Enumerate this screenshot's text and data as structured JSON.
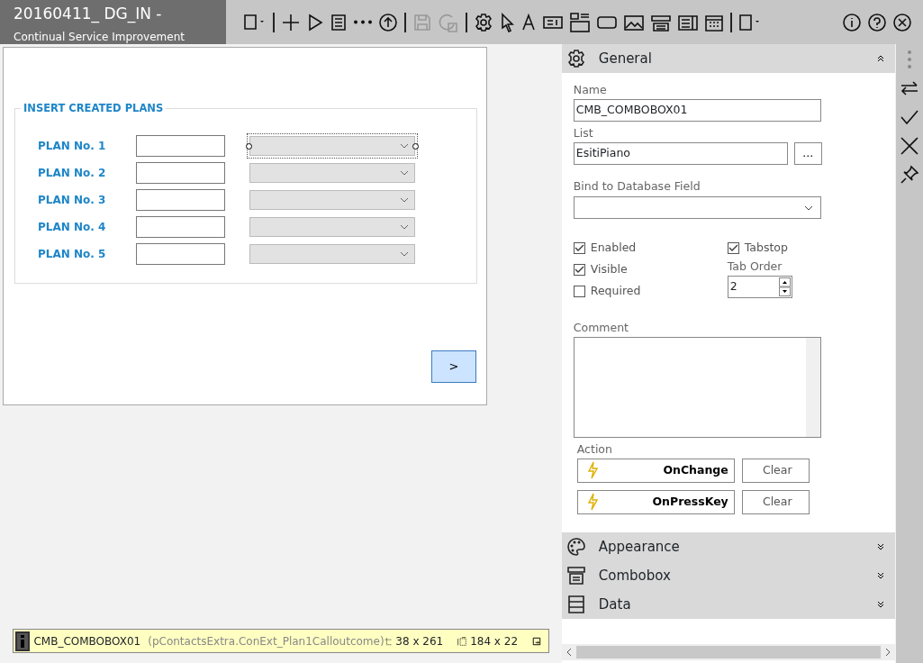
{
  "window": {
    "title": "20160411_ DG_IN -",
    "subtitle": "Continual Service Improvement"
  },
  "toolbar": [
    {
      "kind": "new-page",
      "disabled": false
    },
    {
      "kind": "separator"
    },
    {
      "kind": "add",
      "disabled": false
    },
    {
      "kind": "run",
      "disabled": false
    },
    {
      "kind": "list",
      "disabled": false
    },
    {
      "kind": "more",
      "disabled": false
    },
    {
      "kind": "upload",
      "disabled": false
    },
    {
      "kind": "separator"
    },
    {
      "kind": "save",
      "disabled": true
    },
    {
      "kind": "refresh",
      "disabled": true
    },
    {
      "kind": "separator"
    },
    {
      "kind": "settings",
      "disabled": false
    },
    {
      "kind": "pointer",
      "disabled": false
    },
    {
      "kind": "text",
      "disabled": false
    },
    {
      "kind": "textfield",
      "disabled": false
    },
    {
      "kind": "labelfield",
      "disabled": false
    },
    {
      "kind": "button",
      "disabled": false
    },
    {
      "kind": "image",
      "disabled": false
    },
    {
      "kind": "combobox",
      "disabled": false
    },
    {
      "kind": "listbox",
      "disabled": false
    },
    {
      "kind": "calendar",
      "disabled": false
    },
    {
      "kind": "separator"
    },
    {
      "kind": "page-menu",
      "disabled": false
    }
  ],
  "window_buttons": [
    {
      "kind": "info"
    },
    {
      "kind": "help"
    },
    {
      "kind": "close"
    }
  ],
  "form": {
    "group_title": "INSERT CREATED PLANS",
    "plans": [
      {
        "label": "PLAN No. 1",
        "selected": true
      },
      {
        "label": "PLAN No. 2",
        "selected": false
      },
      {
        "label": "PLAN No. 3",
        "selected": false
      },
      {
        "label": "PLAN No. 4",
        "selected": false
      },
      {
        "label": "PLAN No. 5",
        "selected": false
      }
    ],
    "next_button": ">"
  },
  "status_bar": {
    "name": "CMB_COMBOBOX01",
    "source": "(pContactsExtra.ConExt_Plan1Calloutcome)",
    "position": "38 x 261",
    "size": "184 x 22"
  },
  "properties": {
    "sections": [
      {
        "kind": "general",
        "title": "General",
        "expanded": true
      },
      {
        "kind": "appearance",
        "title": "Appearance",
        "expanded": false
      },
      {
        "kind": "combobox",
        "title": "Combobox",
        "expanded": false
      },
      {
        "kind": "data",
        "title": "Data",
        "expanded": false
      }
    ],
    "name_label": "Name",
    "name_value": "CMB_COMBOBOX01",
    "list_label": "List",
    "list_value": "EsitiPiano",
    "list_button": "...",
    "bind_label": "Bind to Database Field",
    "checks_left": [
      {
        "label": "Enabled",
        "checked": true
      },
      {
        "label": "Visible",
        "checked": true
      },
      {
        "label": "Required",
        "checked": false
      }
    ],
    "tabstop": {
      "label": "Tabstop",
      "checked": true
    },
    "tab_order_label": "Tab Order",
    "tab_order_value": "2",
    "comment_label": "Comment",
    "action_label": "Action",
    "actions": [
      {
        "label": "OnChange",
        "clear": "Clear"
      },
      {
        "label": "OnPressKey",
        "clear": "Clear"
      }
    ]
  },
  "side_tools": [
    {
      "kind": "more"
    },
    {
      "kind": "swap"
    },
    {
      "kind": "check"
    },
    {
      "kind": "close"
    },
    {
      "kind": "pin"
    }
  ]
}
